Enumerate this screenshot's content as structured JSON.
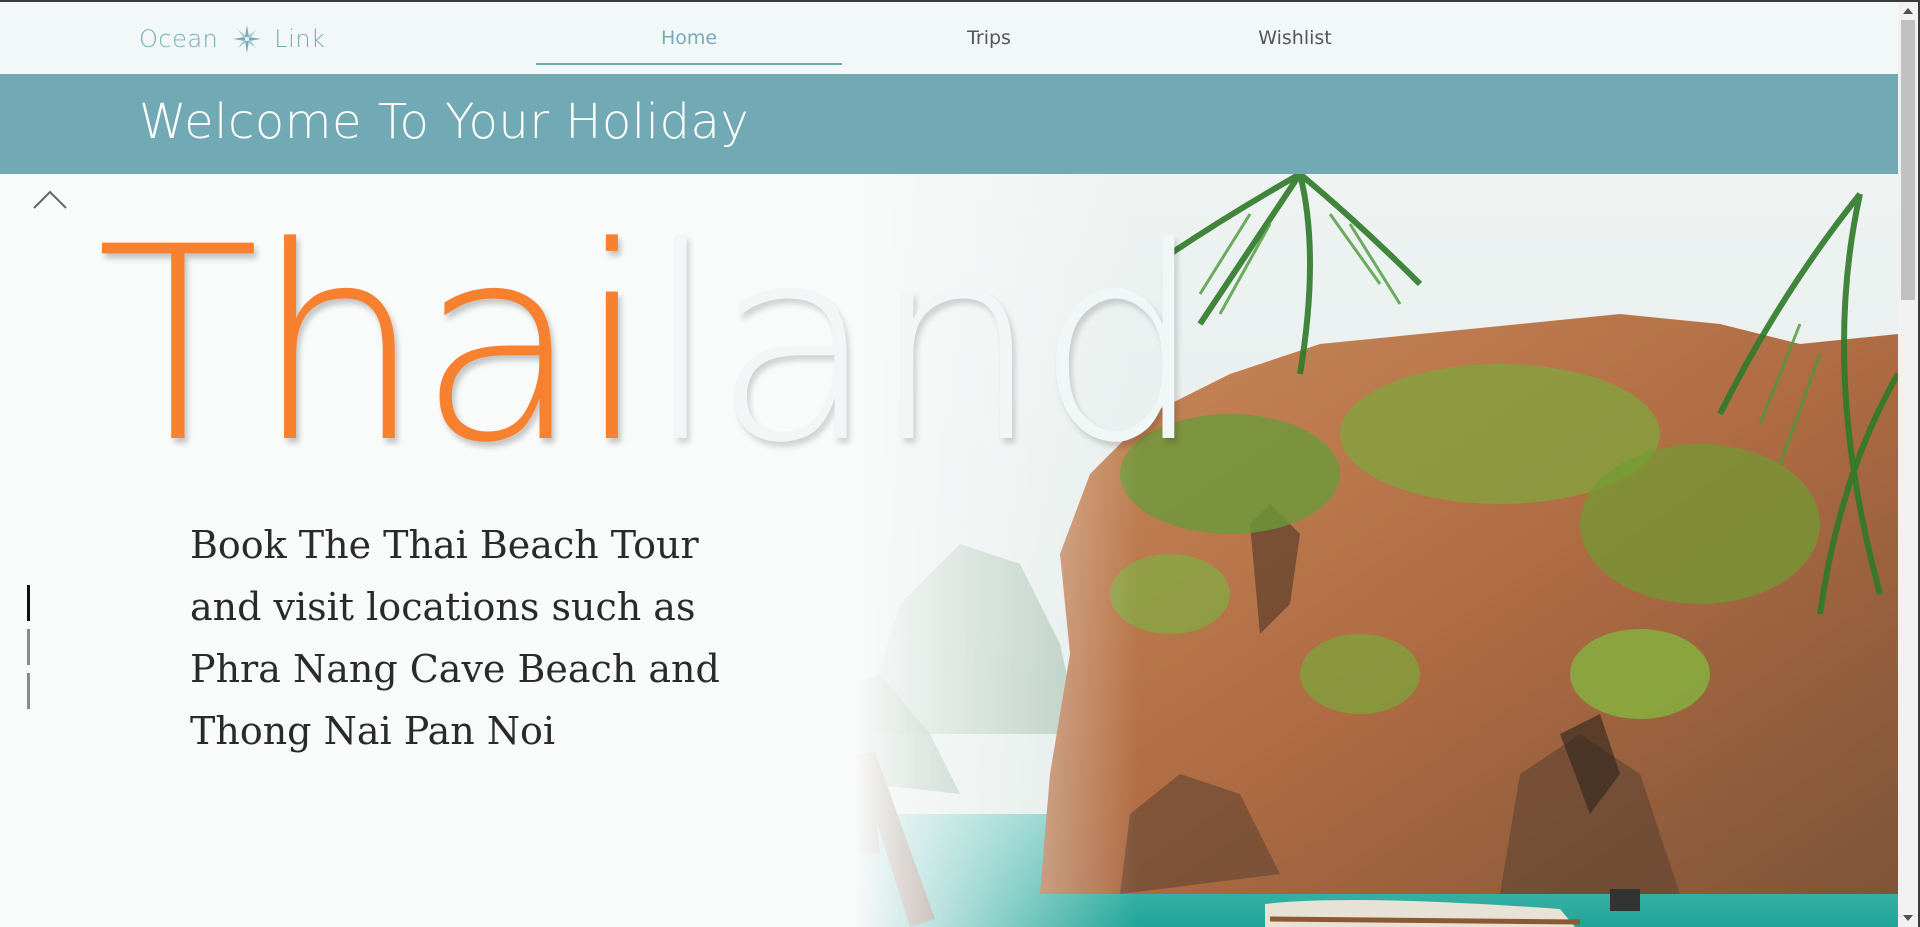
{
  "nav": {
    "brand": {
      "word1": "Ocean",
      "word2": "Link",
      "icon": "compass-rose-icon"
    },
    "links": [
      {
        "label": "Home",
        "active": true
      },
      {
        "label": "Trips",
        "active": false
      },
      {
        "label": "Wishlist",
        "active": false
      }
    ]
  },
  "banner": {
    "title": "Welcome To Your Holiday"
  },
  "hero": {
    "title_part_a": "Thai",
    "title_part_b": "land",
    "description": "Book The Thai Beach Tour and visit locations such as Phra Nang Cave Beach and Thong Nai Pan Noi",
    "slide_count": 3,
    "active_slide": 1
  },
  "colors": {
    "accent_teal": "#71aab5",
    "title_orange": "#f7812e",
    "nav_background": "#f2f8f8"
  }
}
